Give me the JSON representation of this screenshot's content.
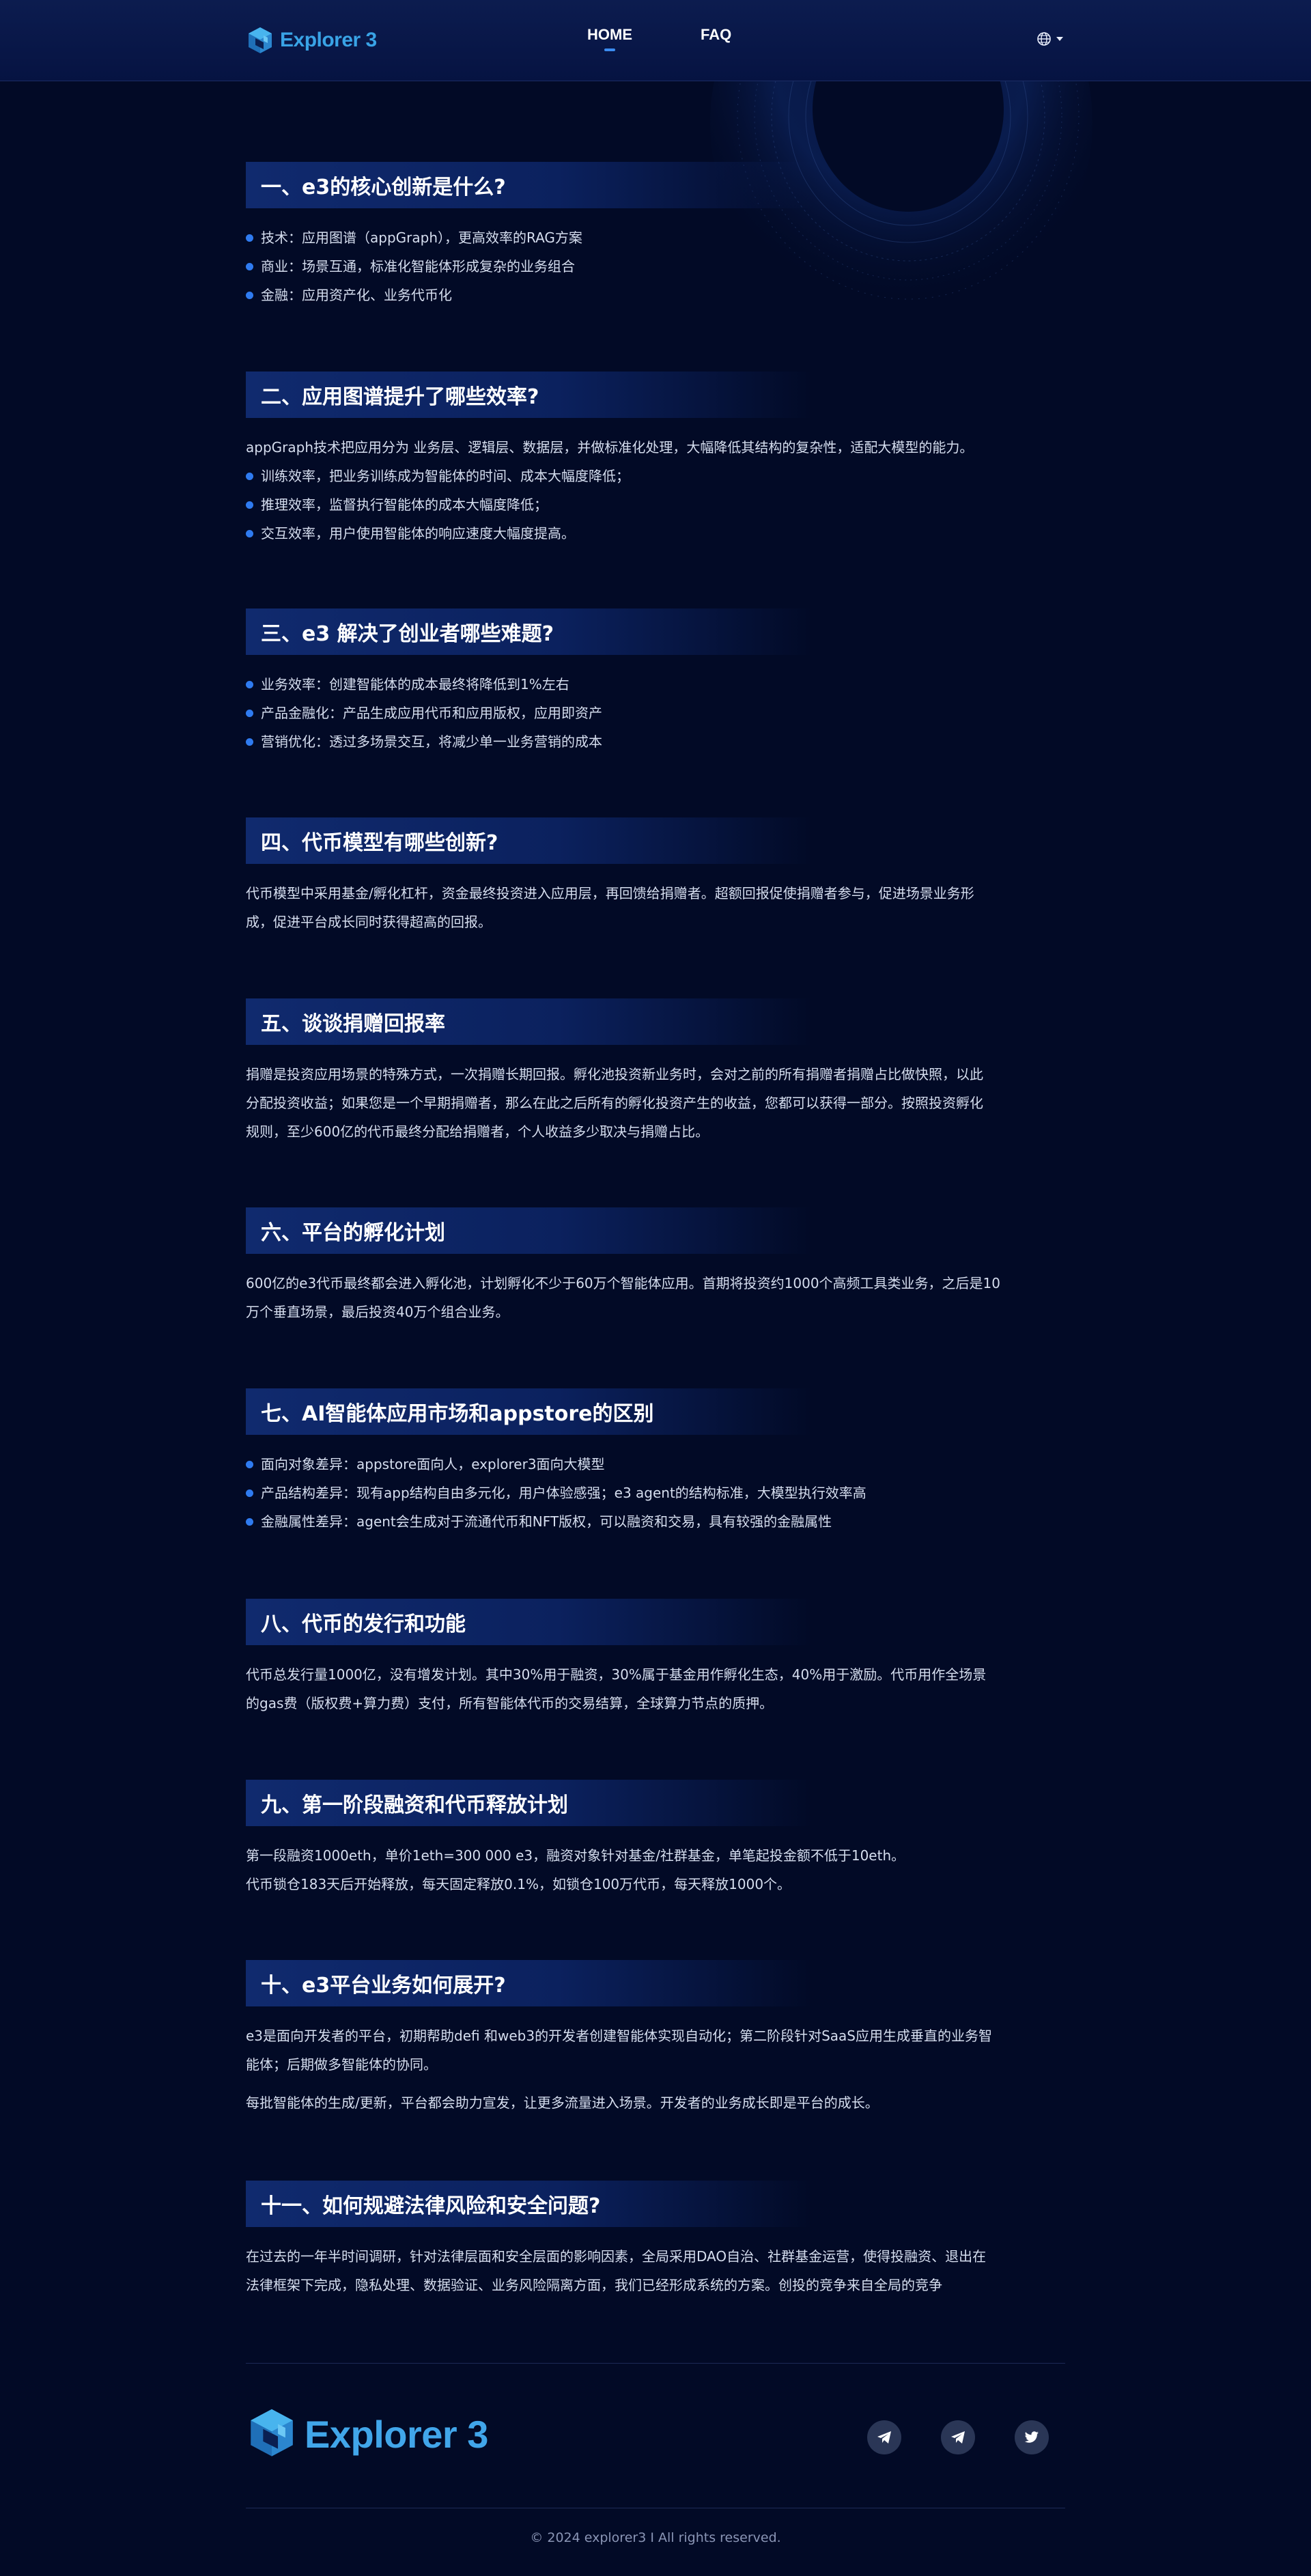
{
  "brand": {
    "name": "Explorer 3",
    "accent": "#39a3e6"
  },
  "nav": {
    "home": "HOME",
    "faq": "FAQ"
  },
  "language": {
    "icon": "globe-icon"
  },
  "sections": [
    {
      "title": "一、e3的核心创新是什么?",
      "bullets": [
        "技术：应用图谱（appGraph），更高效率的RAG方案",
        "商业：场景互通，标准化智能体形成复杂的业务组合",
        "金融：应用资产化、业务代币化"
      ]
    },
    {
      "title": "二、应用图谱提升了哪些效率?",
      "intro": "appGraph技术把应用分为 业务层、逻辑层、数据层，并做标准化处理，大幅降低其结构的复杂性，适配大模型的能力。",
      "bullets": [
        "训练效率，把业务训练成为智能体的时间、成本大幅度降低；",
        "推理效率，监督执行智能体的成本大幅度降低；",
        "交互效率，用户使用智能体的响应速度大幅度提高。"
      ]
    },
    {
      "title": "三、e3 解决了创业者哪些难题?",
      "bullets": [
        "业务效率：创建智能体的成本最终将降低到1%左右",
        "产品金融化：产品生成应用代币和应用版权，应用即资产",
        "营销优化：透过多场景交互，将减少单一业务营销的成本"
      ]
    },
    {
      "title": "四、代币模型有哪些创新?",
      "paras": [
        "代币模型中采用基金/孵化杠杆，资金最终投资进入应用层，再回馈给捐赠者。超额回报促使捐赠者参与，促进场景业务形",
        "成，促进平台成长同时获得超高的回报。"
      ]
    },
    {
      "title": "五、谈谈捐赠回报率",
      "paras": [
        "捐赠是投资应用场景的特殊方式，一次捐赠长期回报。孵化池投资新业务时，会对之前的所有捐赠者捐赠占比做快照，以此",
        "分配投资收益；如果您是一个早期捐赠者，那么在此之后所有的孵化投资产生的收益，您都可以获得一部分。按照投资孵化",
        "规则，至少600亿的代币最终分配给捐赠者，个人收益多少取决与捐赠占比。"
      ]
    },
    {
      "title": "六、平台的孵化计划",
      "paras": [
        "600亿的e3代币最终都会进入孵化池，计划孵化不少于60万个智能体应用。首期将投资约1000个高频工具类业务，之后是10",
        "万个垂直场景，最后投资40万个组合业务。"
      ]
    },
    {
      "title": "七、AI智能体应用市场和appstore的区别",
      "bullets": [
        "面向对象差异：appstore面向人，explorer3面向大模型",
        "产品结构差异：现有app结构自由多元化，用户体验感强；e3 agent的结构标准，大模型执行效率高",
        "金融属性差异：agent会生成对于流通代币和NFT版权，可以融资和交易，具有较强的金融属性"
      ]
    },
    {
      "title": "八、代币的发行和功能",
      "paras": [
        "代币总发行量1000亿，没有增发计划。其中30%用于融资，30%属于基金用作孵化生态，40%用于激励。代币用作全场景",
        "的gas费（版权费+算力费）支付，所有智能体代币的交易结算，全球算力节点的质押。"
      ]
    },
    {
      "title": "九、第一阶段融资和代币释放计划",
      "paras": [
        "第一段融资1000eth，单价1eth=300 000 e3，融资对象针对基金/社群基金，单笔起投金额不低于10eth。",
        "代币锁仓183天后开始释放，每天固定释放0.1%，如锁仓100万代币，每天释放1000个。"
      ]
    },
    {
      "title": "十、e3平台业务如何展开?",
      "paras": [
        "e3是面向开发者的平台，初期帮助defi 和web3的开发者创建智能体实现自动化；第二阶段针对SaaS应用生成垂直的业务智",
        "能体；后期做多智能体的协同。"
      ],
      "paras2": [
        "每批智能体的生成/更新，平台都会助力宣发，让更多流量进入场景。开发者的业务成长即是平台的成长。"
      ]
    },
    {
      "title": "十一、如何规避法律风险和安全问题?",
      "paras": [
        "在过去的一年半时间调研，针对法律层面和安全层面的影响因素，全局采用DAO自治、社群基金运营，使得投融资、退出在",
        "法律框架下完成，隐私处理、数据验证、业务风险隔离方面，我们已经形成系统的方案。创投的竞争来自全局的竞争"
      ]
    }
  ],
  "footer": {
    "brand": "Explorer 3",
    "socials": [
      "telegram-icon",
      "telegram-icon",
      "twitter-icon"
    ],
    "copyright": "© 2024 explorer3 I All rights reserved."
  }
}
